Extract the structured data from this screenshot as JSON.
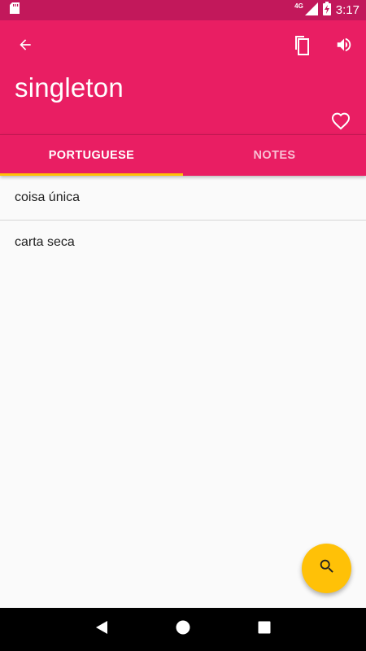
{
  "status_bar": {
    "network": "4G",
    "time": "3:17",
    "icons": [
      "sd-card-icon",
      "signal-icon",
      "battery-charging-icon"
    ]
  },
  "app_bar": {
    "title": "singleton",
    "icons": [
      "arrow-back-icon",
      "copy-icon",
      "volume-icon",
      "heart-outline-icon"
    ]
  },
  "tabs": [
    {
      "label": "PORTUGUESE",
      "active": true
    },
    {
      "label": "NOTES",
      "active": false
    }
  ],
  "translations": [
    "coisa única",
    "carta seca"
  ],
  "fab": {
    "icon": "search-icon"
  },
  "nav_bar": {
    "icons": [
      "back-triangle-icon",
      "home-circle-icon",
      "recents-square-icon"
    ]
  },
  "colors": {
    "status_bar": "#c2185b",
    "primary": "#e91e63",
    "accent": "#ffc107",
    "background": "#fafafa"
  }
}
